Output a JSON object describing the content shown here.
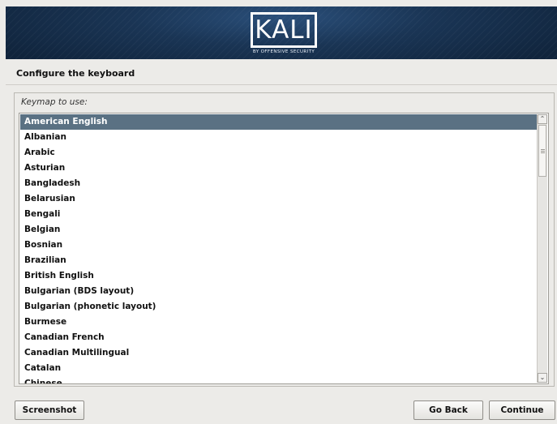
{
  "banner": {
    "logo_text": "KALI",
    "logo_subtitle": "BY OFFENSIVE SECURITY"
  },
  "page": {
    "title": "Configure the keyboard"
  },
  "keymap": {
    "label": "Keymap to use:",
    "selected": "American English",
    "items": [
      "American English",
      "Albanian",
      "Arabic",
      "Asturian",
      "Bangladesh",
      "Belarusian",
      "Bengali",
      "Belgian",
      "Bosnian",
      "Brazilian",
      "British English",
      "Bulgarian (BDS layout)",
      "Bulgarian (phonetic layout)",
      "Burmese",
      "Canadian French",
      "Canadian Multilingual",
      "Catalan",
      "Chinese"
    ]
  },
  "buttons": {
    "screenshot": "Screenshot",
    "go_back": "Go Back",
    "continue": "Continue"
  },
  "colors": {
    "selection": "#5a7183",
    "banner": "#1a3555",
    "background": "#ecebe8"
  }
}
